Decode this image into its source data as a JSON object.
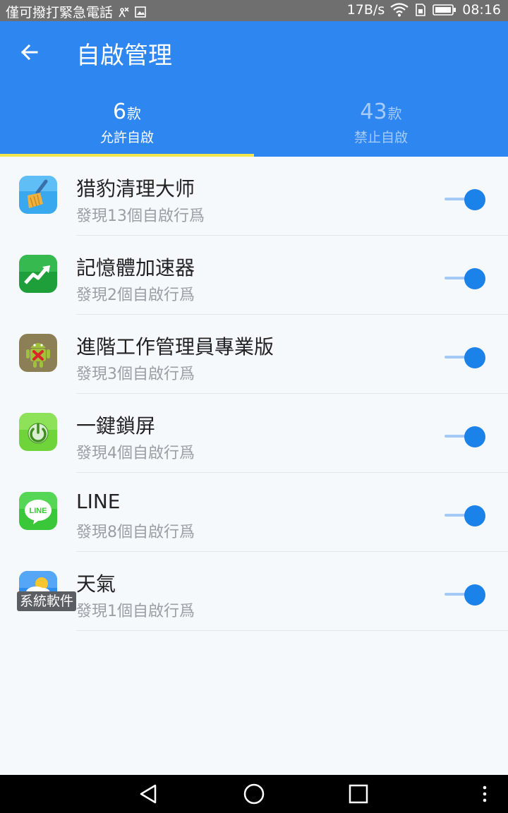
{
  "status_bar": {
    "left_text": "僅可撥打緊急電話",
    "network_speed": "17B/s",
    "time": "08:16",
    "icons": [
      "no-sim-icon",
      "image-icon",
      "wifi-icon",
      "sim-card-icon",
      "battery-icon"
    ]
  },
  "header": {
    "title": "自啟管理",
    "back_icon": "arrow-left-icon",
    "background_color": "#2e86f0"
  },
  "tabs": [
    {
      "count": "6",
      "unit": "款",
      "label": "允許自啟",
      "selected": true
    },
    {
      "count": "43",
      "unit": "款",
      "label": "禁止自啟",
      "selected": false
    }
  ],
  "apps": [
    {
      "name": "猎豹清理大师",
      "detail": "發現13個自啟行爲",
      "icon": "broom-icon",
      "enabled": true
    },
    {
      "name": "記憶體加速器",
      "detail": "發現2個自啟行爲",
      "icon": "chart-up-icon",
      "enabled": true
    },
    {
      "name": "進階工作管理員專業版",
      "detail": "發現3個自啟行爲",
      "icon": "android-robot-icon",
      "enabled": true
    },
    {
      "name": "一鍵鎖屏",
      "detail": "發現4個自啟行爲",
      "icon": "power-icon",
      "enabled": true
    },
    {
      "name": "LINE",
      "detail": "發現8個自啟行爲",
      "icon": "line-icon",
      "icon_text": "LINE",
      "enabled": true
    },
    {
      "name": "天氣",
      "detail": "發現1個自啟行爲",
      "icon": "weather-icon",
      "enabled": true,
      "badge": "系統軟件"
    }
  ],
  "nav_bar": {
    "buttons": [
      "back-triangle-icon",
      "home-circle-icon",
      "recents-square-icon",
      "more-dots-icon"
    ]
  },
  "colors": {
    "accent": "#1a82e8",
    "tab_indicator": "#f2e64a",
    "status_bar": "#6f6f6f"
  }
}
